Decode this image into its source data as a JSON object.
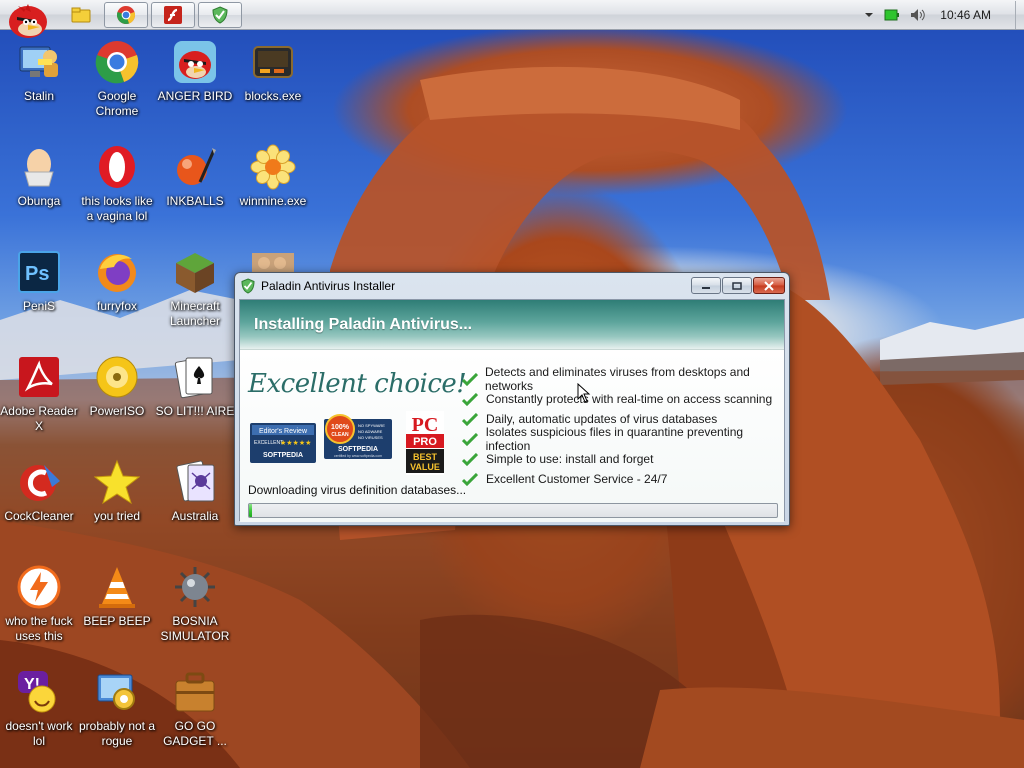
{
  "taskbar": {
    "clock": "10:46 AM",
    "pinned": [
      {
        "name": "chrome"
      },
      {
        "name": "flash"
      },
      {
        "name": "paladin-antivirus"
      }
    ]
  },
  "desktop": {
    "icons": [
      {
        "label": "Stalin",
        "icon": "monitor-user-icon"
      },
      {
        "label": "Google Chrome",
        "icon": "chrome-icon"
      },
      {
        "label": "ANGER BIRD",
        "icon": "angry-bird-icon"
      },
      {
        "label": "blocks.exe",
        "icon": "blocks-icon"
      },
      {
        "label": "Obunga",
        "icon": "egg-icon"
      },
      {
        "label": "this looks like a vagina lol",
        "icon": "opera-icon"
      },
      {
        "label": "INKBALLS",
        "icon": "inkball-icon"
      },
      {
        "label": "winmine.exe",
        "icon": "flower-icon"
      },
      {
        "label": "PeniS",
        "icon": "photoshop-icon"
      },
      {
        "label": "furryfox",
        "icon": "firefox-icon"
      },
      {
        "label": "Minecraft Launcher",
        "icon": "minecraft-icon"
      },
      {
        "label": "",
        "icon": "photo-icon"
      },
      {
        "label": "Adobe Reader X",
        "icon": "adobe-reader-icon"
      },
      {
        "label": "PowerISO",
        "icon": "disc-icon"
      },
      {
        "label": "SO LIT!!! AIRE",
        "icon": "cards-icon"
      },
      {
        "label": "CockCleaner",
        "icon": "ccleaner-icon"
      },
      {
        "label": "you tried",
        "icon": "star-icon"
      },
      {
        "label": "Australia",
        "icon": "spider-solitaire-icon"
      },
      {
        "label": "who the fuck uses this",
        "icon": "avast-icon"
      },
      {
        "label": "BEEP BEEP",
        "icon": "vlc-icon"
      },
      {
        "label": "BOSNIA SIMULATOR",
        "icon": "minesweeper-icon"
      },
      {
        "label": "doesn't work lol",
        "icon": "yahoo-messenger-icon"
      },
      {
        "label": "probably not a rogue",
        "icon": "system-settings-icon"
      },
      {
        "label": "GO GO GADGET ...",
        "icon": "briefcase-icon"
      }
    ]
  },
  "installer": {
    "title": "Paladin Antivirus Installer",
    "banner": "Installing Paladin Antivirus...",
    "tagline": "Excellent choice!",
    "features": [
      "Detects and eliminates viruses from desktops and networks",
      "Constantly protects with real-time on access scanning",
      "Daily, automatic updates of virus databases",
      "Isolates suspicious files in quarantine preventing infection",
      "Simple to use: install and forget",
      "Excellent Customer Service - 24/7"
    ],
    "status": "Downloading virus definition databases...",
    "progress_fraction": 0.005,
    "badges": {
      "editors_review": "Editor's Review",
      "excellent": "EXCELLENT",
      "softpedia": "SOFTPEDIA",
      "clean_percent": "100%",
      "clean_word": "CLEAN",
      "no_spyware": "NO SPYWARE",
      "no_adware": "NO ADWARE",
      "no_viruses": "NO VIRUSES",
      "certified": "certified by www.softpedia.com",
      "pc": "PC",
      "pro": "PRO",
      "best": "BEST",
      "value": "VALUE"
    }
  }
}
